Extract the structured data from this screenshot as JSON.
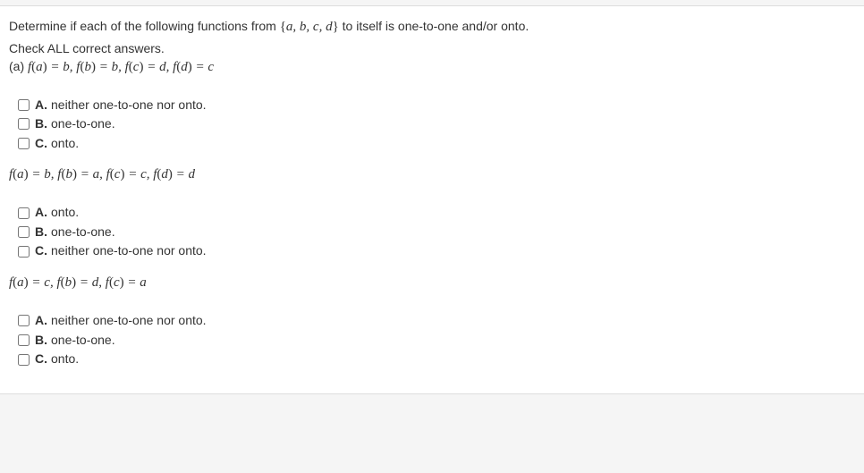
{
  "question": {
    "intro_pre": "Determine if each of the following functions from ",
    "set": "{a, b, c, d}",
    "intro_post": " to itself is one-to-one and/or onto.",
    "instruction": "Check ALL correct answers.",
    "part_a_label": "(a) ",
    "part_a_func": "f(a) = b, f(b) = b, f(c) = d, f(d) = c"
  },
  "group1": {
    "choices": [
      {
        "letter": "A.",
        "text": "neither one-to-one nor onto."
      },
      {
        "letter": "B.",
        "text": "one-to-one."
      },
      {
        "letter": "C.",
        "text": "onto."
      }
    ]
  },
  "func2": "f(a) = b, f(b) = a, f(c) = c, f(d) = d",
  "group2": {
    "choices": [
      {
        "letter": "A.",
        "text": "onto."
      },
      {
        "letter": "B.",
        "text": "one-to-one."
      },
      {
        "letter": "C.",
        "text": "neither one-to-one nor onto."
      }
    ]
  },
  "func3": "f(a) = c, f(b) = d, f(c) = a",
  "group3": {
    "choices": [
      {
        "letter": "A.",
        "text": "neither one-to-one nor onto."
      },
      {
        "letter": "B.",
        "text": "one-to-one."
      },
      {
        "letter": "C.",
        "text": "onto."
      }
    ]
  }
}
